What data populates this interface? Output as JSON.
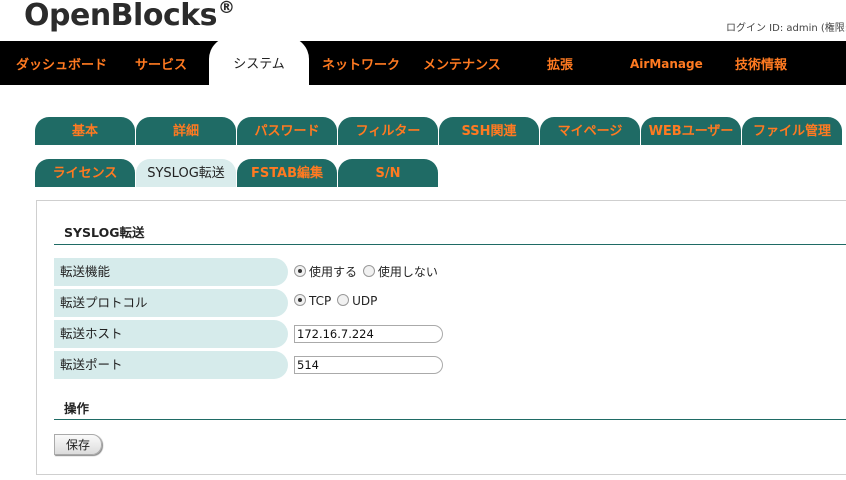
{
  "header": {
    "brand": "OpenBlocks",
    "brand_mark": "®",
    "login_info": "ログイン ID: admin (権限: ..."
  },
  "mainnav": {
    "tabs": [
      {
        "label": "ダッシュボード"
      },
      {
        "label": "サービス"
      },
      {
        "label": "システム",
        "active": true
      },
      {
        "label": "ネットワーク"
      },
      {
        "label": "メンテナンス"
      },
      {
        "label": "拡張"
      },
      {
        "label": "AirManage"
      },
      {
        "label": "技術情報"
      }
    ]
  },
  "subtabs": {
    "row1": [
      "基本",
      "詳細",
      "パスワード",
      "フィルター",
      "SSH関連",
      "マイページ",
      "WEBユーザー",
      "ファイル管理"
    ],
    "row2": [
      "ライセンス",
      "SYSLOG転送",
      "FSTAB編集",
      "S/N"
    ],
    "active": "SYSLOG転送"
  },
  "form": {
    "section_title": "SYSLOG転送",
    "fields": {
      "transfer_function": {
        "label": "転送機能",
        "option_on": "使用する",
        "option_off": "使用しない",
        "selected": "使用する"
      },
      "protocol": {
        "label": "転送プロトコル",
        "option_tcp": "TCP",
        "option_udp": "UDP",
        "selected": "TCP"
      },
      "host": {
        "label": "転送ホスト",
        "value": "172.16.7.224"
      },
      "port": {
        "label": "転送ポート",
        "value": "514"
      }
    },
    "operation_title": "操作",
    "save_label": "保存"
  }
}
